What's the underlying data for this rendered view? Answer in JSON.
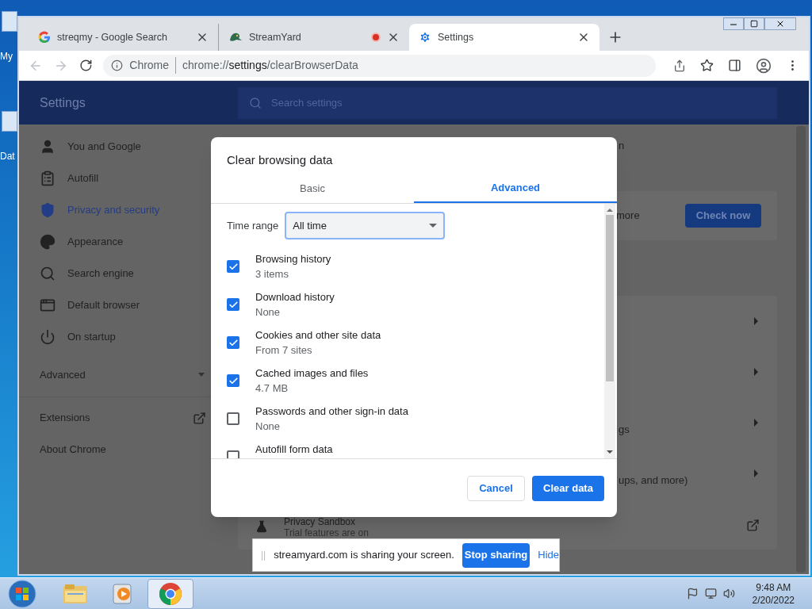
{
  "desktop": {
    "icons": [
      {
        "label": "My"
      },
      {
        "label": "Dat"
      }
    ]
  },
  "browser": {
    "tabs": [
      {
        "title": "streqmy - Google Search",
        "recording": false,
        "selected": false
      },
      {
        "title": "StreamYard",
        "recording": true,
        "selected": false
      },
      {
        "title": "Settings",
        "recording": false,
        "selected": true
      }
    ],
    "address": {
      "site_label": "Chrome",
      "url_scheme": "chrome://",
      "url_host": "settings",
      "url_path": "/clearBrowserData"
    }
  },
  "settings": {
    "title": "Settings",
    "search": {
      "placeholder": "Search settings"
    },
    "sidebar": {
      "items": [
        {
          "label": "You and Google",
          "selected": false
        },
        {
          "label": "Autofill",
          "selected": false
        },
        {
          "label": "Privacy and security",
          "selected": true
        },
        {
          "label": "Appearance",
          "selected": false
        },
        {
          "label": "Search engine",
          "selected": false
        },
        {
          "label": "Default browser",
          "selected": false
        },
        {
          "label": "On startup",
          "selected": false
        }
      ],
      "advanced": {
        "label": "Advanced",
        "expanded": false
      },
      "links": [
        {
          "label": "Extensions",
          "external": true
        },
        {
          "label": "About Chrome",
          "external": false
        }
      ]
    },
    "main": {
      "heading_fragment": "n",
      "safety_card": {
        "text_fragment": "more",
        "button": "Check now"
      },
      "rows": [
        {
          "kind": "arrow"
        },
        {
          "kind": "arrow"
        },
        {
          "kind": "arrow",
          "text": "gs"
        },
        {
          "kind": "arrow",
          "text": "ups, and more)"
        },
        {
          "kind": "external",
          "title": "Privacy Sandbox",
          "subtitle": "Trial features are on"
        }
      ]
    }
  },
  "dialog": {
    "title": "Clear browsing data",
    "tabs": [
      {
        "label": "Basic",
        "selected": false
      },
      {
        "label": "Advanced",
        "selected": true
      }
    ],
    "time_range": {
      "label": "Time range",
      "value": "All time"
    },
    "options": [
      {
        "label": "Browsing history",
        "detail": "3 items",
        "checked": true
      },
      {
        "label": "Download history",
        "detail": "None",
        "checked": true
      },
      {
        "label": "Cookies and other site data",
        "detail": "From 7 sites",
        "checked": true
      },
      {
        "label": "Cached images and files",
        "detail": "4.7 MB",
        "checked": true
      },
      {
        "label": "Passwords and other sign-in data",
        "detail": "None",
        "checked": false
      },
      {
        "label": "Autofill form data",
        "checked": false
      }
    ],
    "buttons": {
      "cancel": "Cancel",
      "confirm": "Clear data"
    }
  },
  "share_bar": {
    "grip": "||",
    "text": "streamyard.com is sharing your screen.",
    "stop": "Stop sharing",
    "hide": "Hide"
  },
  "taskbar": {
    "apps": [
      {
        "selected": false
      },
      {
        "selected": false
      },
      {
        "selected": true
      }
    ],
    "time": "9:48 AM",
    "date": "2/20/2022"
  }
}
